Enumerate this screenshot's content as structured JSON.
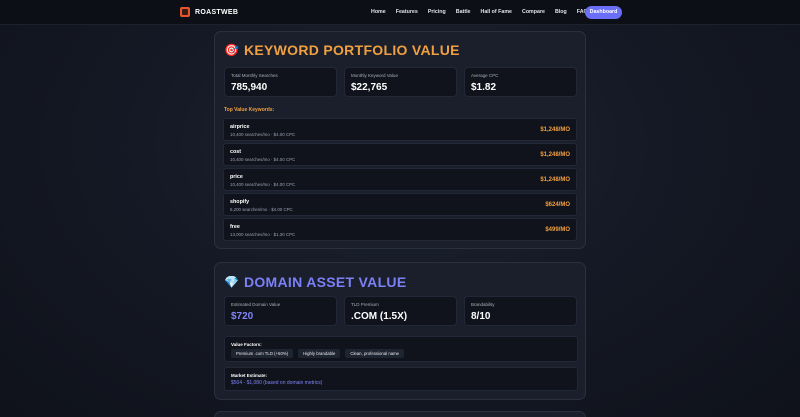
{
  "nav": {
    "brand": "ROASTWEB",
    "links": [
      "Home",
      "Features",
      "Pricing",
      "Battle",
      "Hall of Fame",
      "Compare",
      "Blog",
      "FAQ"
    ],
    "cta": "Dashboard",
    "accent": "#6b6ef6"
  },
  "keyword_section": {
    "emoji": "🎯",
    "title": "KEYWORD PORTFOLIO VALUE",
    "stats": [
      {
        "label": "Total Monthly Searches",
        "value": "785,940"
      },
      {
        "label": "Monthly Keyword Value",
        "value": "$22,765"
      },
      {
        "label": "Average CPC",
        "value": "$1.82"
      }
    ],
    "top_label": "Top Value Keywords:",
    "keywords": [
      {
        "name": "airprice",
        "meta": "10,400 searches/mo · $4.00 CPC",
        "value": "$1,248/MO"
      },
      {
        "name": "cost",
        "meta": "10,400 searches/mo · $4.00 CPC",
        "value": "$1,248/MO"
      },
      {
        "name": "price",
        "meta": "10,400 searches/mo · $4.00 CPC",
        "value": "$1,248/MO"
      },
      {
        "name": "shopify",
        "meta": "5,200 searches/mo · $4.00 CPC",
        "value": "$624/MO"
      },
      {
        "name": "free",
        "meta": "13,000 searches/mo · $1.30 CPC",
        "value": "$499/MO"
      }
    ],
    "accent": "#f0a040"
  },
  "domain_section": {
    "emoji": "💎",
    "title": "DOMAIN ASSET VALUE",
    "stats": [
      {
        "label": "Estimated Domain Value",
        "value": "$720"
      },
      {
        "label": "TLD Premium",
        "value": ".COM (1.5X)"
      },
      {
        "label": "Brandability",
        "value": "8/10"
      }
    ],
    "factors_label": "Value Factors:",
    "factors": [
      "Premium .com TLD (+50%)",
      "Highly brandable",
      "Clean, professional name"
    ],
    "market_label": "Market Estimate:",
    "market_value": "$504 - $1,080 (based on domain metrics)",
    "accent": "#7c80f7"
  }
}
